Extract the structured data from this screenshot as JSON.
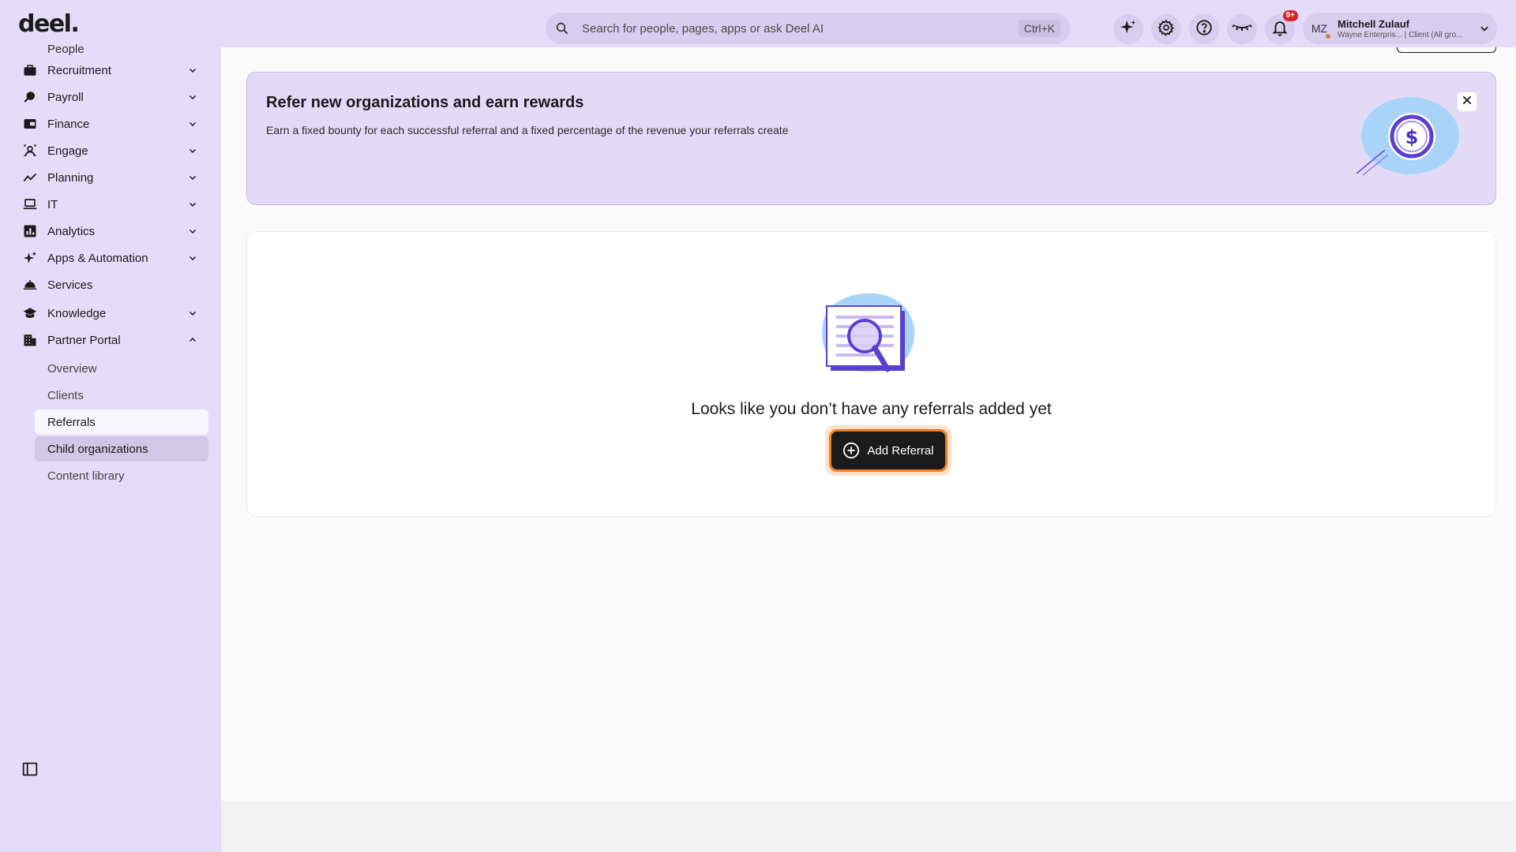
{
  "app": {
    "logo": "deel."
  },
  "search": {
    "placeholder": "Search for people, pages, apps or ask Deel AI",
    "shortcut": "Ctrl+K"
  },
  "topbar": {
    "icons": [
      "ai-sparkle-icon",
      "settings-gear-icon",
      "help-circle-icon",
      "eye-closed-icon",
      "notification-bell-icon"
    ],
    "notification_badge": "9+"
  },
  "profile": {
    "initials": "MZ",
    "name": "Mitchell Zulauf",
    "subtitle": "Wayne Enterpris... | Client (All gro..."
  },
  "sidebar": {
    "partial_item": "People",
    "items": [
      {
        "label": "Recruitment",
        "icon": "briefcase-icon",
        "expandable": true
      },
      {
        "label": "Payroll",
        "icon": "payroll-icon",
        "expandable": true
      },
      {
        "label": "Finance",
        "icon": "wallet-icon",
        "expandable": true
      },
      {
        "label": "Engage",
        "icon": "engage-icon",
        "expandable": true
      },
      {
        "label": "Planning",
        "icon": "trend-line-icon",
        "expandable": true
      },
      {
        "label": "IT",
        "icon": "laptop-icon",
        "expandable": true
      },
      {
        "label": "Analytics",
        "icon": "bar-chart-icon",
        "expandable": true
      },
      {
        "label": "Apps & Automation",
        "icon": "sparkle-icon",
        "expandable": true
      },
      {
        "label": "Services",
        "icon": "service-bell-icon",
        "expandable": false
      },
      {
        "label": "Knowledge",
        "icon": "graduation-cap-icon",
        "expandable": true
      },
      {
        "label": "Partner Portal",
        "icon": "building-icon",
        "expandable": true,
        "expanded": true
      }
    ],
    "sub_items": [
      {
        "label": "Overview"
      },
      {
        "label": "Clients"
      },
      {
        "label": "Referrals",
        "active": true
      },
      {
        "label": "Child organizations",
        "hover": true
      },
      {
        "label": "Content library"
      }
    ]
  },
  "banner": {
    "title": "Refer new organizations and earn rewards",
    "description": "Earn a fixed bounty for each successful referral and a fixed percentage of the revenue your referrals create",
    "coin_symbol": "$"
  },
  "empty_state": {
    "message": "Looks like you don’t have any referrals added yet",
    "button_label": "Add Referral"
  },
  "colors": {
    "sidebar_bg": "#e4dcf9",
    "banner_bg": "#e3daf8",
    "accent_orange": "#f47a20",
    "button_dark": "#1b1b1b",
    "badge_red": "#d8232a"
  }
}
